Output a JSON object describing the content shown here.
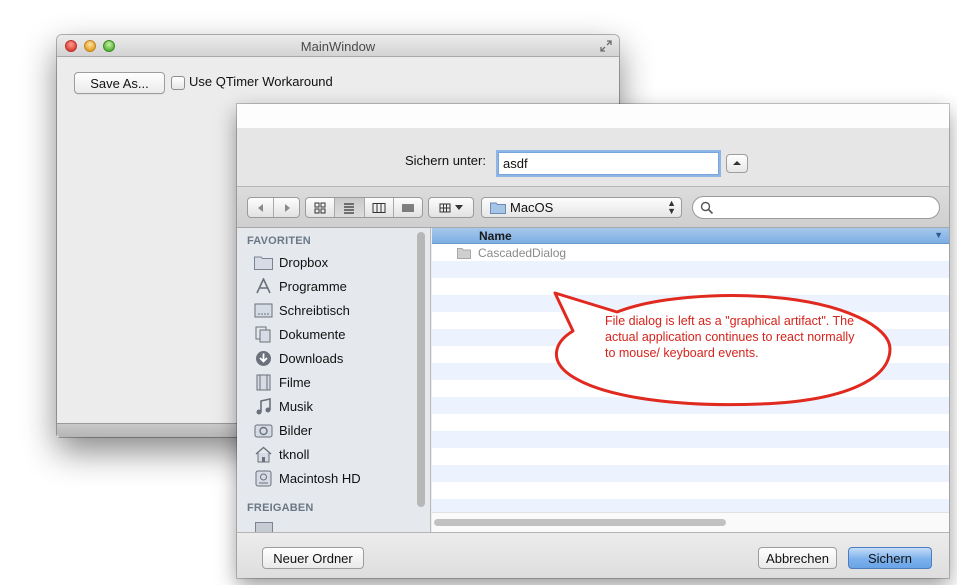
{
  "main_window": {
    "title": "MainWindow",
    "save_as_button": "Save As...",
    "workaround_checkbox_label": "Use QTimer Workaround",
    "workaround_checked": false
  },
  "save_dialog": {
    "save_as_label": "Sichern unter:",
    "filename_value": "asdf",
    "location": "MacOS",
    "search_placeholder": "",
    "sidebar": {
      "favorites_heading": "FAVORITEN",
      "favorites": [
        {
          "label": "Dropbox",
          "icon": "folder-icon"
        },
        {
          "label": "Programme",
          "icon": "applications-icon"
        },
        {
          "label": "Schreibtisch",
          "icon": "desktop-icon"
        },
        {
          "label": "Dokumente",
          "icon": "documents-icon"
        },
        {
          "label": "Downloads",
          "icon": "downloads-icon"
        },
        {
          "label": "Filme",
          "icon": "movies-icon"
        },
        {
          "label": "Musik",
          "icon": "music-icon"
        },
        {
          "label": "Bilder",
          "icon": "pictures-icon"
        },
        {
          "label": "tknoll",
          "icon": "home-icon"
        },
        {
          "label": "Macintosh HD",
          "icon": "hard-drive-icon"
        }
      ],
      "shared_heading": "FREIGABEN"
    },
    "list": {
      "column_name": "Name",
      "files": [
        {
          "name": "CascadedDialog",
          "icon": "folder-icon"
        }
      ]
    },
    "buttons": {
      "new_folder": "Neuer Ordner",
      "cancel": "Abbrechen",
      "save": "Sichern"
    }
  },
  "annotation": {
    "text": "File dialog is left as a \"graphical artifact\". The actual application continues to react normally to mouse/ keyboard events.",
    "color": "#e0291f"
  }
}
